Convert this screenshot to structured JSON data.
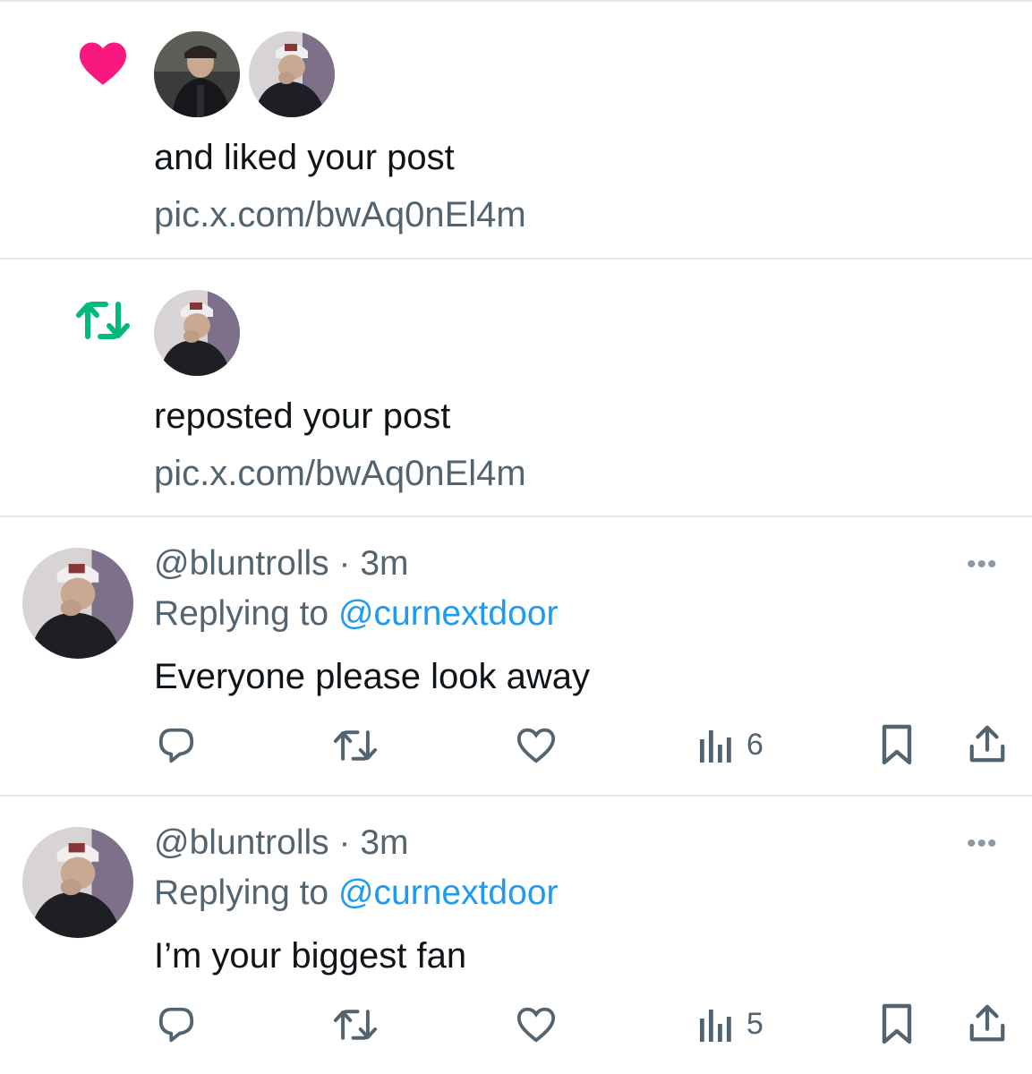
{
  "notifications": [
    {
      "type": "like",
      "icon": "heart-icon",
      "icon_color": "#f91880",
      "avatars": [
        "avatar-1",
        "avatar-2"
      ],
      "text": "and liked your post",
      "link": "pic.x.com/bwAq0nEl4m"
    },
    {
      "type": "repost",
      "icon": "repost-icon",
      "icon_color": "#00ba7c",
      "avatars": [
        "avatar-2"
      ],
      "text": "reposted your post",
      "link": "pic.x.com/bwAq0nEl4m"
    }
  ],
  "replies": [
    {
      "handle": "@bluntrolls",
      "separator": "·",
      "time": "3m",
      "replying_prefix": "Replying to ",
      "replying_to": "@curnextdoor",
      "text": "Everyone please look away",
      "views": "6",
      "more_label": "•••"
    },
    {
      "handle": "@bluntrolls",
      "separator": "·",
      "time": "3m",
      "replying_prefix": "Replying to ",
      "replying_to": "@curnextdoor",
      "text": "I’m your biggest fan",
      "views": "5",
      "more_label": "•••"
    }
  ],
  "colors": {
    "accent_blue": "#1d9bf0",
    "secondary_text": "#536471",
    "divider": "#e6e8ea"
  }
}
